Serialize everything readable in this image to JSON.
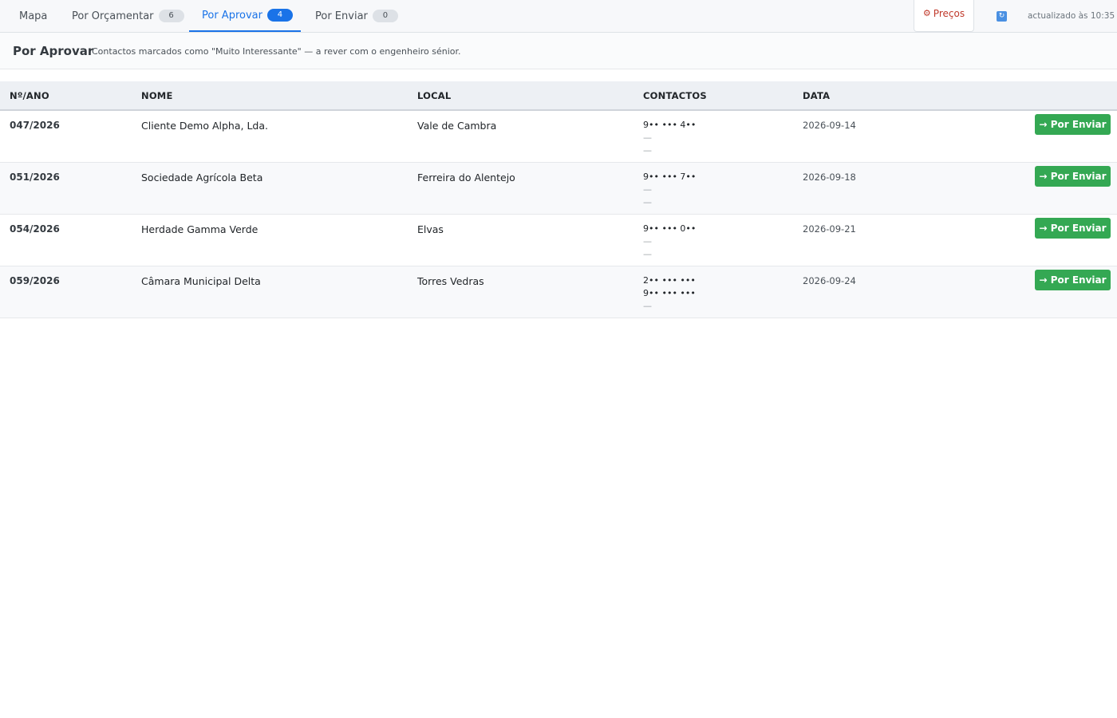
{
  "tabs": [
    {
      "label": "Mapa",
      "count": null
    },
    {
      "label": "Por Orçamentar",
      "count": "6"
    },
    {
      "label": "Por Aprovar",
      "count": "4"
    },
    {
      "label": "Por Enviar",
      "count": "0"
    }
  ],
  "topbar": {
    "precos_label": "Preços",
    "precos_icon": "⚙",
    "refresh_icon": "🔄",
    "updated_text": "actualizado às 10:35"
  },
  "section": {
    "title": "Por Aprovar",
    "description": "Contactos marcados como \"Muito Interessante\" — a rever com o engenheiro sénior."
  },
  "table": {
    "headers": [
      "Nº/ANO",
      "NOME",
      "LOCAL",
      "CONTACTOS",
      "DATA"
    ],
    "action_label": "→ Por Enviar",
    "rows": [
      {
        "num": "047/2026",
        "nome": "Cliente Demo Alpha, Lda.",
        "local": "Vale de Cambra",
        "contacts": [
          "9•• ••• 4••",
          "—",
          "—"
        ],
        "data": "2026-09-14"
      },
      {
        "num": "051/2026",
        "nome": "Sociedade Agrícola Beta",
        "local": "Ferreira do Alentejo",
        "contacts": [
          "9•• ••• 7••",
          "—",
          "—"
        ],
        "data": "2026-09-18"
      },
      {
        "num": "054/2026",
        "nome": "Herdade Gamma Verde",
        "local": "Elvas",
        "contacts": [
          "9•• ••• 0••",
          "—",
          "—"
        ],
        "data": "2026-09-21"
      },
      {
        "num": "059/2026",
        "nome": "Câmara Municipal Delta",
        "local": "Torres Vedras",
        "contacts": [
          "2•• ••• •••",
          "9•• ••• •••",
          "—"
        ],
        "data": "2026-09-24"
      }
    ]
  },
  "colors": {
    "accent": "#1a73e8",
    "success": "#34a853",
    "danger": "#c0392b"
  }
}
